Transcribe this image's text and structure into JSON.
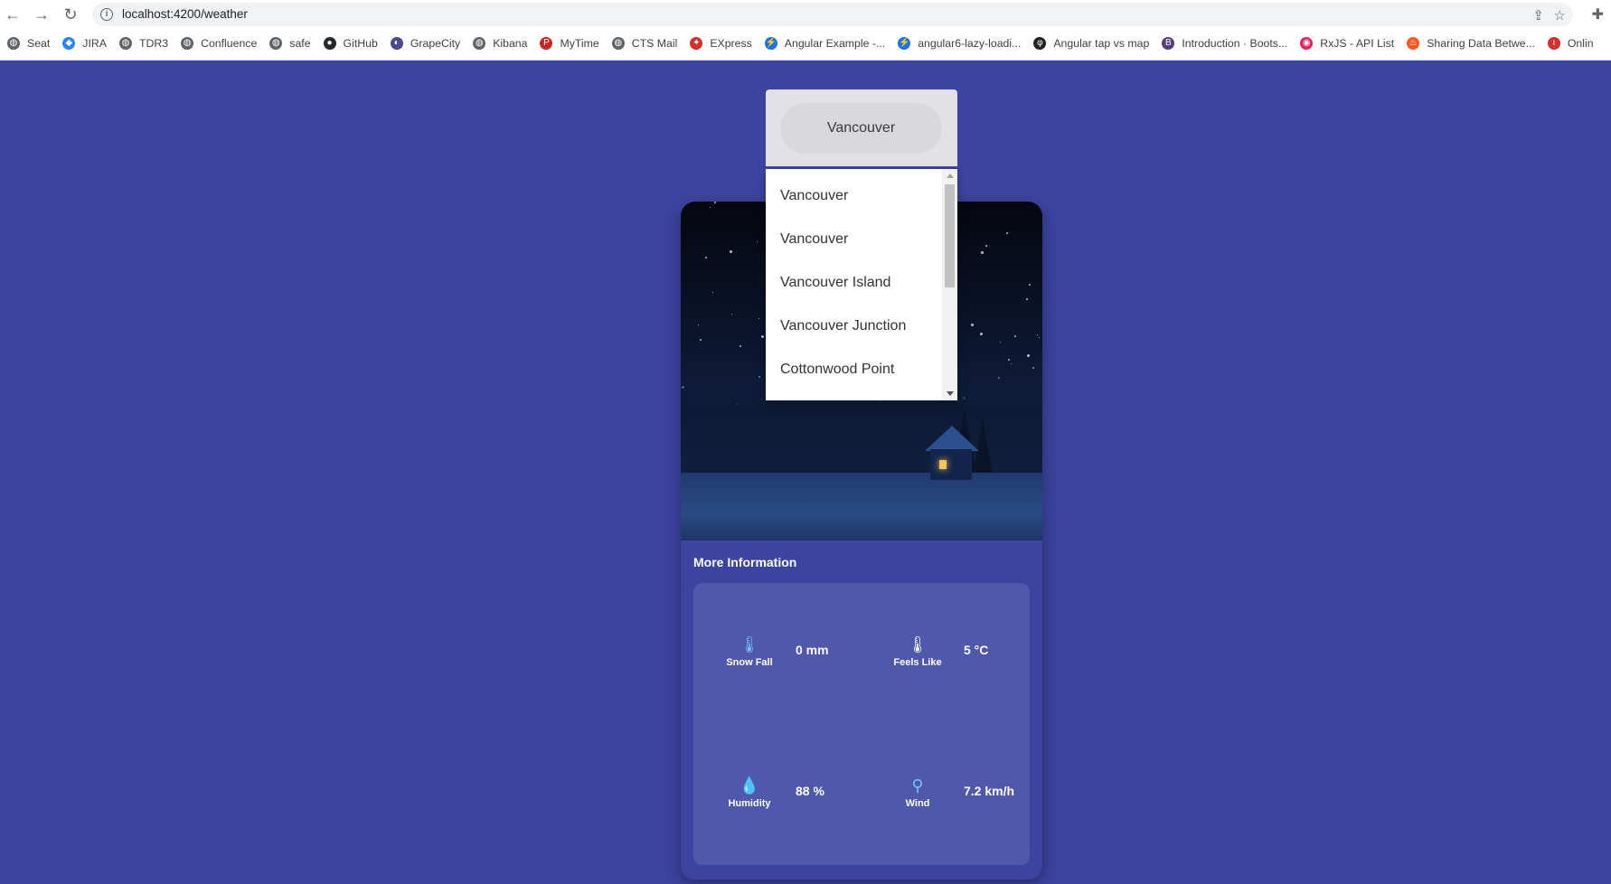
{
  "browser": {
    "url": "localhost:4200/weather",
    "nav": {
      "back_icon": "arrow-left-icon",
      "forward_icon": "arrow-right-icon",
      "reload_icon": "reload-icon"
    },
    "bookmarks": [
      {
        "label": "Seat",
        "icon": "globe-icon",
        "color": "#5f6368"
      },
      {
        "label": "JIRA",
        "icon": "jira-icon",
        "color": "#2684ff"
      },
      {
        "label": "TDR3",
        "icon": "globe-icon",
        "color": "#5f6368"
      },
      {
        "label": "Confluence",
        "icon": "globe-icon",
        "color": "#5f6368"
      },
      {
        "label": "safe",
        "icon": "globe-icon",
        "color": "#5f6368"
      },
      {
        "label": "GitHub",
        "icon": "github-icon",
        "color": "#24292e"
      },
      {
        "label": "GrapeCity",
        "icon": "grapecity-icon",
        "color": "#4a4a8a"
      },
      {
        "label": "Kibana",
        "icon": "globe-icon",
        "color": "#5f6368"
      },
      {
        "label": "MyTime",
        "icon": "mytime-icon",
        "color": "#c62828"
      },
      {
        "label": "CTS Mail",
        "icon": "globe-icon",
        "color": "#5f6368"
      },
      {
        "label": "EXpress",
        "icon": "maple-leaf-icon",
        "color": "#d32f2f"
      },
      {
        "label": "Angular Example -...",
        "icon": "bolt-icon",
        "color": "#1a73e8"
      },
      {
        "label": "angular6-lazy-loadi...",
        "icon": "bolt-icon",
        "color": "#1a73e8"
      },
      {
        "label": "Angular tap vs map",
        "icon": "tap-icon",
        "color": "#212121"
      },
      {
        "label": "Introduction · Boots...",
        "icon": "bootstrap-icon",
        "color": "#563d7c"
      },
      {
        "label": "RxJS - API List",
        "icon": "rxjs-icon",
        "color": "#e91e63"
      },
      {
        "label": "Sharing Data Betwe...",
        "icon": "flame-icon",
        "color": "#ff5722"
      },
      {
        "label": "Onlin",
        "icon": "online-icon",
        "color": "#d32f2f"
      }
    ]
  },
  "search": {
    "value": "Vancouver",
    "options": [
      "Vancouver",
      "Vancouver",
      "Vancouver Island",
      "Vancouver Junction",
      "Cottonwood Point"
    ]
  },
  "weather": {
    "section_title": "More Information",
    "metrics": [
      {
        "label": "Snow Fall",
        "value": "0 mm",
        "icon": "snow-thermometer-icon"
      },
      {
        "label": "Feels Like",
        "value": "5 °C",
        "icon": "thermometer-icon"
      },
      {
        "label": "Humidity",
        "value": "88 %",
        "icon": "humidity-drop-icon"
      },
      {
        "label": "Wind",
        "value": "7.2 km/h",
        "icon": "wind-turbine-icon"
      }
    ]
  },
  "colors": {
    "page_background": "#3c44a0",
    "info_panel": "#5058ad",
    "accent_icon": "#6ec6ff"
  }
}
